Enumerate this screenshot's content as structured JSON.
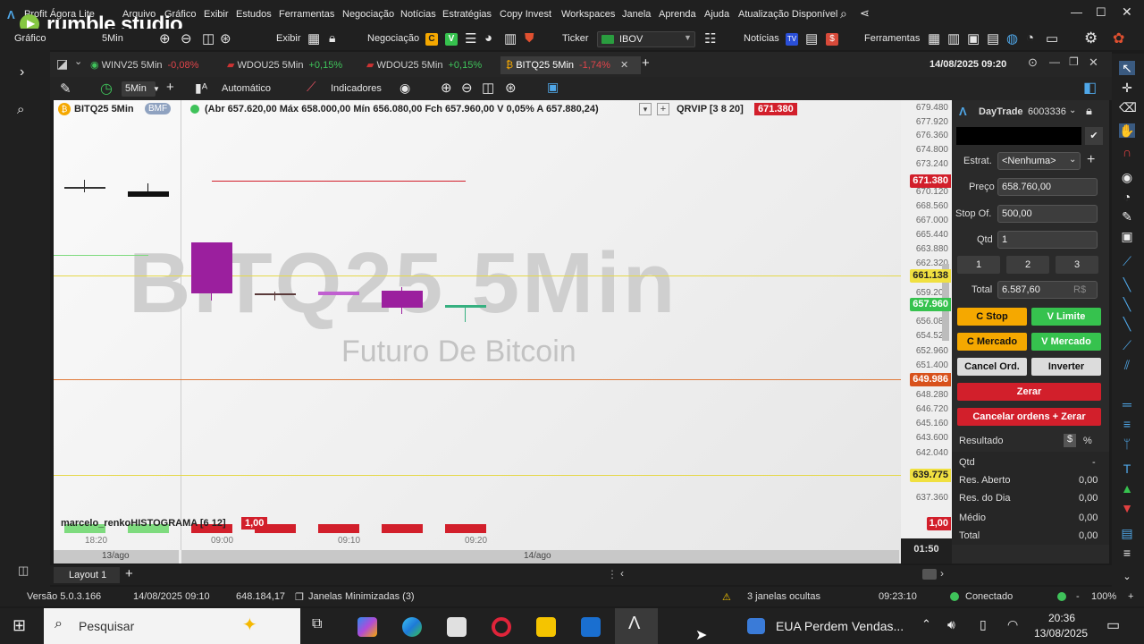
{
  "menubar": {
    "app_title": "Profit Ágora Lite",
    "items": [
      "Arquivo",
      "Gráfico",
      "Exibir",
      "Estudos",
      "Ferramentas",
      "Negociação",
      "Notícias",
      "Estratégias",
      "Copy Invest",
      "Workspaces",
      "Janela",
      "Aprenda",
      "Ajuda",
      "Atualização Disponível"
    ]
  },
  "watermark_logo": "rumble studio",
  "toolbar": {
    "grafico_label": "Gráfico",
    "timeframe": "5Min",
    "exibir": "Exibir",
    "negociacao": "Negociação",
    "badge_c": "C",
    "badge_v": "V",
    "ticker_label": "Ticker",
    "ticker_value": "IBOV",
    "noticias": "Notícias",
    "ferramentas": "Ferramentas"
  },
  "tabs": [
    {
      "label": "WINV25 5Min",
      "change": "-0,08%",
      "up": false
    },
    {
      "label": "WDOU25 5Min",
      "change": "+0,15%",
      "up": true
    },
    {
      "label": "WDOU25 5Min",
      "change": "+0,15%",
      "up": true
    },
    {
      "label": "BITQ25 5Min",
      "change": "-1,74%",
      "up": false,
      "active": true
    }
  ],
  "datetime": "14/08/2025 09:20",
  "charttools": {
    "timeframe": "5Min",
    "mode": "Automático",
    "indicators": "Indicadores"
  },
  "chart_header": {
    "symbol": "BITQ25 5Min",
    "exchange": "BMF",
    "ohlc": "(Abr 657.620,00 Máx 658.000,00 Mín 656.080,00 Fch 657.960,00 V 0,05% A 657.880,24)",
    "study": "QRVIP [3 8 20]",
    "study_value": "671.380"
  },
  "watermark": {
    "title": "BITQ25 5Min",
    "subtitle": "Futuro De Bitcoin"
  },
  "yaxis_ticks": [
    "679.480",
    "677.920",
    "676.360",
    "674.800",
    "673.240",
    "670.120",
    "668.560",
    "667.000",
    "665.440",
    "663.880",
    "662.320",
    "659.200",
    "656.080",
    "654.520",
    "652.960",
    "651.400",
    "648.280",
    "646.720",
    "645.160",
    "643.600",
    "642.040",
    "637.360"
  ],
  "price_labels": [
    {
      "value": "671.380",
      "bg": "#d21f2b",
      "fg": "#ffffff"
    },
    {
      "value": "661.138",
      "bg": "#f0e040",
      "fg": "#222222"
    },
    {
      "value": "657.960",
      "bg": "#36c24e",
      "fg": "#ffffff"
    },
    {
      "value": "649.986",
      "bg": "#d8521c",
      "fg": "#ffffff"
    },
    {
      "value": "639.775",
      "bg": "#f0e040",
      "fg": "#222222"
    },
    {
      "value": "1,00",
      "bg": "#d21f2b",
      "fg": "#ffffff"
    }
  ],
  "indicator": {
    "label": "marcelo_renkoHISTOGRAMA [6 12]",
    "value": "1,00"
  },
  "time_labels": [
    "18:20",
    "09:00",
    "09:10",
    "09:20"
  ],
  "date_labels": [
    "13/ago",
    "14/ago"
  ],
  "clock": "01:50",
  "layout_label": "Layout 1",
  "panel": {
    "title": "DayTrade",
    "account": "6003336",
    "estrat_label": "Estrat.",
    "estrat_value": "<Nenhuma>",
    "preco_label": "Preço",
    "preco_value": "658.760,00",
    "stop_label": "Stop Of.",
    "stop_value": "500,00",
    "qtd_label": "Qtd",
    "qtd_value": "1",
    "quick_qtys": [
      "1",
      "2",
      "3"
    ],
    "total_label": "Total",
    "total_value": "6.587,60",
    "total_unit": "R$",
    "btn_c_stop": "C Stop",
    "btn_v_limite": "V Limite",
    "btn_c_mercado": "C Mercado",
    "btn_v_mercado": "V Mercado",
    "btn_cancel_ord": "Cancel Ord.",
    "btn_inverter": "Inverter",
    "btn_zerar": "Zerar",
    "btn_cancelar_zerar": "Cancelar ordens + Zerar",
    "resultado_label": "Resultado",
    "res_rows": [
      {
        "label": "Qtd",
        "value": "-"
      },
      {
        "label": "Res. Aberto",
        "value": "0,00"
      },
      {
        "label": "Res. do Dia",
        "value": "0,00"
      },
      {
        "label": "Médio",
        "value": "0,00"
      },
      {
        "label": "Total",
        "value": "0,00"
      }
    ]
  },
  "status": {
    "version": "Versão 5.0.3.166",
    "datetime": "14/08/2025 09:10",
    "value": "648.184,17",
    "minimized": "Janelas Minimizadas (3)",
    "hidden": "3 janelas ocultas",
    "time": "09:23:10",
    "connection": "Conectado",
    "zoom": "100%"
  },
  "taskbar": {
    "search_placeholder": "Pesquisar",
    "news": "EUA Perdem Vendas...",
    "time": "20:36",
    "date": "13/08/2025"
  },
  "colors": {
    "buy": "#36c24e",
    "sell": "#d21f2b",
    "stop_btn": "#f5a800",
    "candle_purple": "#9b1f9e"
  }
}
